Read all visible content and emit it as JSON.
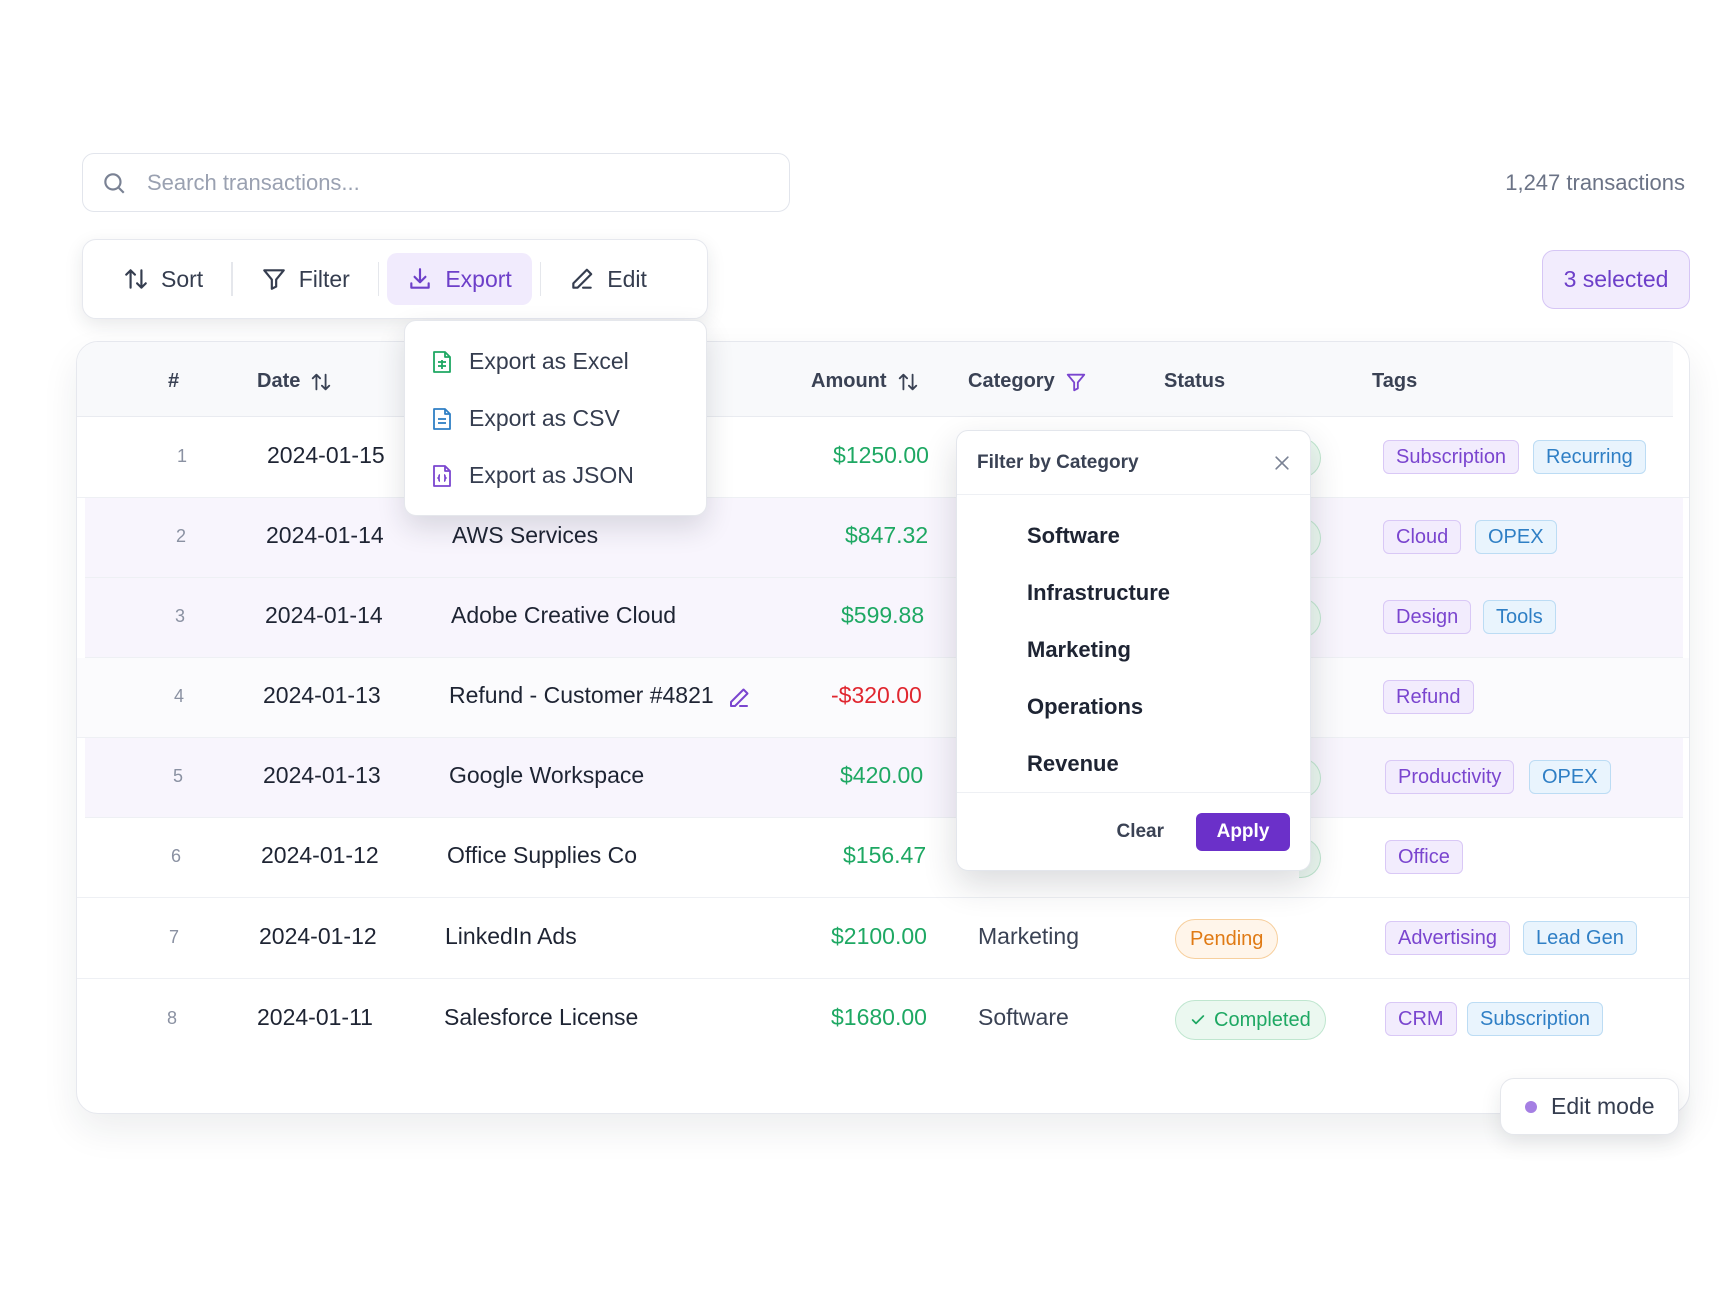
{
  "search": {
    "placeholder": "Search transactions..."
  },
  "transaction_count": "1,247 transactions",
  "toolbar": {
    "sort": "Sort",
    "filter": "Filter",
    "export": "Export",
    "edit": "Edit"
  },
  "selected_label": "3 selected",
  "export_menu": {
    "items": [
      {
        "label": "Export as Excel",
        "icon": "excel-file-icon",
        "color": "#1ea863"
      },
      {
        "label": "Export as CSV",
        "icon": "csv-file-icon",
        "color": "#2f7fc5"
      },
      {
        "label": "Export as JSON",
        "icon": "json-file-icon",
        "color": "#7a45cf"
      }
    ]
  },
  "table": {
    "headers": {
      "index": "#",
      "date": "Date",
      "amount": "Amount",
      "category": "Category",
      "status": "Status",
      "tags": "Tags"
    },
    "rows": [
      {
        "idx": "1",
        "date": "2024-01-15",
        "description": "",
        "amount": "$1250.00",
        "category": "",
        "status": "",
        "tags": [
          "Subscription",
          "Recurring"
        ]
      },
      {
        "idx": "2",
        "date": "2024-01-14",
        "description": "AWS Services",
        "amount": "$847.32",
        "category": "",
        "status": "",
        "tags": [
          "Cloud",
          "OPEX"
        ]
      },
      {
        "idx": "3",
        "date": "2024-01-14",
        "description": "Adobe Creative Cloud",
        "amount": "$599.88",
        "category": "",
        "status": "",
        "tags": [
          "Design",
          "Tools"
        ]
      },
      {
        "idx": "4",
        "date": "2024-01-13",
        "description": "Refund - Customer #4821",
        "amount": "-$320.00",
        "category": "",
        "status": "",
        "tags": [
          "Refund"
        ]
      },
      {
        "idx": "5",
        "date": "2024-01-13",
        "description": "Google Workspace",
        "amount": "$420.00",
        "category": "",
        "status": "",
        "tags": [
          "Productivity",
          "OPEX"
        ]
      },
      {
        "idx": "6",
        "date": "2024-01-12",
        "description": "Office Supplies Co",
        "amount": "$156.47",
        "category": "",
        "status": "",
        "tags": [
          "Office"
        ]
      },
      {
        "idx": "7",
        "date": "2024-01-12",
        "description": "LinkedIn Ads",
        "amount": "$2100.00",
        "category": "Marketing",
        "status": "Pending",
        "tags": [
          "Advertising",
          "Lead Gen"
        ]
      },
      {
        "idx": "8",
        "date": "2024-01-11",
        "description": "Salesforce License",
        "amount": "$1680.00",
        "category": "Software",
        "status": "Completed",
        "tags": [
          "CRM",
          "Subscription"
        ]
      }
    ]
  },
  "filter_popup": {
    "title": "Filter by Category",
    "options": [
      "Software",
      "Infrastructure",
      "Marketing",
      "Operations",
      "Revenue"
    ],
    "clear": "Clear",
    "apply": "Apply"
  },
  "edit_mode": "Edit mode",
  "colors": {
    "accent": "#6b30c9",
    "positive": "#1ea863",
    "negative": "#e0262f",
    "pending": "#e07a14"
  }
}
